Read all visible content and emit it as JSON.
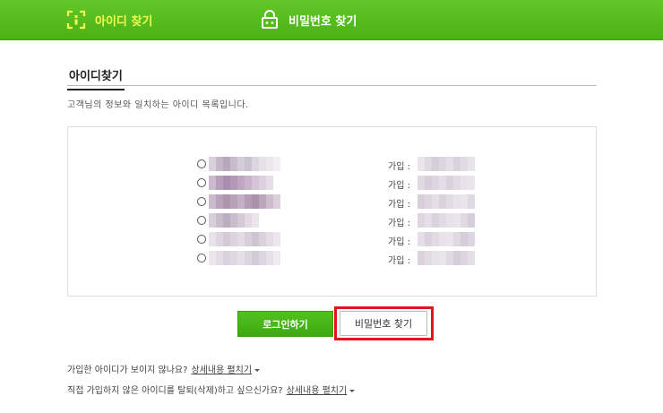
{
  "tabs": {
    "find_id": "아이디 찾기",
    "find_password": "비밀번호 찾기"
  },
  "section": {
    "title": "아이디찾기",
    "description": "고객님의 정보와 일치하는 아이디 목록입니다."
  },
  "results": {
    "join_label": "가입 :",
    "row_count": 6
  },
  "buttons": {
    "login": "로그인하기",
    "find_password": "비밀번호 찾기"
  },
  "help": {
    "line1_text": "가입한 아이디가 보이지 않나요?",
    "line1_link": "상세내용 펼치기",
    "line2_text": "직접 가입하지 않은 아이디를 탈퇴(삭제)하고 싶으신가요?",
    "line2_link": "상세내용 펼치기"
  },
  "colors": {
    "header_green": "#4cb214",
    "active_tab_text": "#f3f94e",
    "login_button": "#3ea912",
    "highlight_box": "#e4141c"
  },
  "icons": {
    "find_id_tab": "id-card-bracket-icon",
    "find_password_tab": "padlock-icon"
  }
}
